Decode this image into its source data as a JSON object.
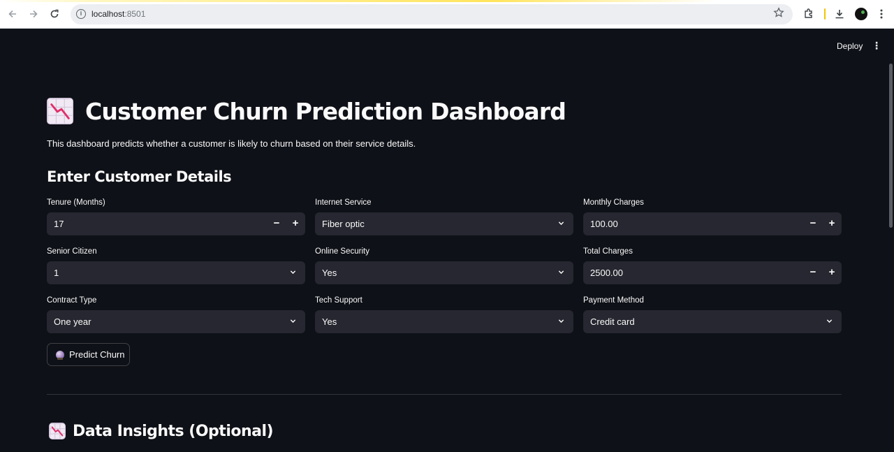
{
  "browser": {
    "url_host": "localhost",
    "url_port": ":8501"
  },
  "toolbar": {
    "deploy_label": "Deploy"
  },
  "page": {
    "title": "Customer Churn Prediction Dashboard",
    "subtitle": "This dashboard predicts whether a customer is likely to churn based on their service details.",
    "form_heading": "Enter Customer Details",
    "insights_heading": "Data Insights (Optional)"
  },
  "form": {
    "tenure": {
      "label": "Tenure (Months)",
      "value": "17"
    },
    "internet_service": {
      "label": "Internet Service",
      "value": "Fiber optic"
    },
    "monthly_charges": {
      "label": "Monthly Charges",
      "value": "100.00"
    },
    "senior_citizen": {
      "label": "Senior Citizen",
      "value": "1"
    },
    "online_security": {
      "label": "Online Security",
      "value": "Yes"
    },
    "total_charges": {
      "label": "Total Charges",
      "value": "2500.00"
    },
    "contract_type": {
      "label": "Contract Type",
      "value": "One year"
    },
    "tech_support": {
      "label": "Tech Support",
      "value": "Yes"
    },
    "payment_method": {
      "label": "Payment Method",
      "value": "Credit card"
    },
    "predict_label": "Predict Churn"
  },
  "icons": {
    "title_emoji": "chart-decreasing-icon",
    "predict_emoji": "crystal-ball-icon"
  },
  "colors": {
    "background": "#0e1117",
    "input_bg": "#262730",
    "text": "#fafafa"
  }
}
